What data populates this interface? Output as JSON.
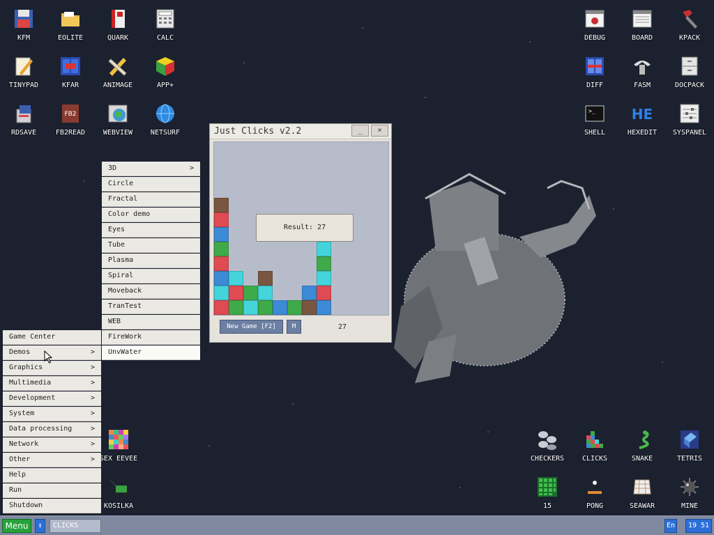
{
  "desktop": {
    "icons_left": [
      {
        "label": "KFM",
        "icon": "floppy-disk-icon"
      },
      {
        "label": "EOLITE",
        "icon": "folder-icon"
      },
      {
        "label": "QUARK",
        "icon": "red-book-icon"
      },
      {
        "label": "CALC",
        "icon": "calculator-icon"
      },
      {
        "label": "TINYPAD",
        "icon": "notepad-pencil-icon"
      },
      {
        "label": "KFAR",
        "icon": "dual-panel-icon"
      },
      {
        "label": "ANIMAGE",
        "icon": "pencil-ruler-icon"
      },
      {
        "label": "APP+",
        "icon": "rubik-cube-icon"
      },
      {
        "label": "RDSAVE",
        "icon": "ramdisk-save-icon"
      },
      {
        "label": "FB2READ",
        "icon": "fb2-book-icon"
      },
      {
        "label": "WEBVIEW",
        "icon": "webview-globe-icon"
      },
      {
        "label": "NETSURF",
        "icon": "blue-globe-icon"
      }
    ],
    "icons_right": [
      {
        "label": "DEBUG",
        "icon": "bug-window-icon"
      },
      {
        "label": "BOARD",
        "icon": "board-window-icon"
      },
      {
        "label": "KPACK",
        "icon": "hammer-icon"
      },
      {
        "label": "DIFF",
        "icon": "diff-icon"
      },
      {
        "label": "FASM",
        "icon": "assembler-icon"
      },
      {
        "label": "DOCPACK",
        "icon": "cabinet-icon"
      },
      {
        "label": "SHELL",
        "icon": "terminal-icon"
      },
      {
        "label": "HEXEDIT",
        "icon": "hex-editor-icon"
      },
      {
        "label": "SYSPANEL",
        "icon": "sliders-icon"
      }
    ],
    "icons_bottom_left": [
      {
        "label": "SEX EEVEE",
        "icon": "color-grid-icon"
      },
      {
        "label": "KOSILKA",
        "icon": "lawnmower-icon"
      }
    ],
    "icons_bottom_right": [
      {
        "label": "CHECKERS",
        "icon": "checkers-icon"
      },
      {
        "label": "CLICKS",
        "icon": "clicks-blocks-icon"
      },
      {
        "label": "SNAKE",
        "icon": "snake-icon"
      },
      {
        "label": "TETRIS",
        "icon": "tetris-icon"
      },
      {
        "label": "15",
        "icon": "fifteen-puzzle-icon"
      },
      {
        "label": "PONG",
        "icon": "pong-icon"
      },
      {
        "label": "SEAWAR",
        "icon": "battleship-icon"
      },
      {
        "label": "MINE",
        "icon": "mine-icon"
      }
    ]
  },
  "window": {
    "title": "Just Clicks v2.2",
    "minimize_label": "_",
    "close_label": "×",
    "result_text": "Result: 27",
    "new_game_label": "New Game [F2]",
    "m_label": "M",
    "score": "27",
    "colors": {
      "red": "#e04a52",
      "green": "#3faa4a",
      "cyan": "#44d4dc",
      "blue": "#3d8ad6",
      "brown": "#7a5640"
    },
    "columns": [
      [
        "red",
        "cyan",
        "blue",
        "red",
        "green",
        "blue",
        "red",
        "brown"
      ],
      [
        "green",
        "red",
        "cyan"
      ],
      [
        "cyan",
        "green"
      ],
      [
        "green",
        "cyan",
        "brown"
      ],
      [
        "blue"
      ],
      [
        "green"
      ],
      [
        "brown",
        "blue"
      ],
      [
        "blue",
        "red",
        "cyan",
        "green",
        "cyan"
      ]
    ]
  },
  "main_menu": {
    "items": [
      {
        "label": "Game Center",
        "arrow": ""
      },
      {
        "label": "Demos",
        "arrow": ">"
      },
      {
        "label": "Graphics",
        "arrow": ">"
      },
      {
        "label": "Multimedia",
        "arrow": ">"
      },
      {
        "label": "Development",
        "arrow": ">"
      },
      {
        "label": "System",
        "arrow": ">"
      },
      {
        "label": "Data processing",
        "arrow": ">"
      },
      {
        "label": "Network",
        "arrow": ">"
      },
      {
        "label": "Other",
        "arrow": ">"
      },
      {
        "label": "Help",
        "arrow": ""
      },
      {
        "label": "Run",
        "arrow": ""
      },
      {
        "label": "Shutdown",
        "arrow": ""
      }
    ]
  },
  "demos_menu": {
    "items": [
      {
        "label": "3D",
        "arrow": ">"
      },
      {
        "label": "Circle",
        "arrow": ""
      },
      {
        "label": "Fractal",
        "arrow": ""
      },
      {
        "label": "Color demo",
        "arrow": ""
      },
      {
        "label": "Eyes",
        "arrow": ""
      },
      {
        "label": "Tube",
        "arrow": ""
      },
      {
        "label": "Plasma",
        "arrow": ""
      },
      {
        "label": "Spiral",
        "arrow": ""
      },
      {
        "label": "Moveback",
        "arrow": ""
      },
      {
        "label": "TranTest",
        "arrow": ""
      },
      {
        "label": "WEB",
        "arrow": ""
      },
      {
        "label": "FireWork",
        "arrow": ""
      },
      {
        "label": "UnvWater",
        "arrow": ""
      }
    ]
  },
  "taskbar": {
    "menu_label": "Menu",
    "switch_label": "↕",
    "task_label": "CLICKS",
    "lang_label": "En",
    "clock": "19 51"
  }
}
